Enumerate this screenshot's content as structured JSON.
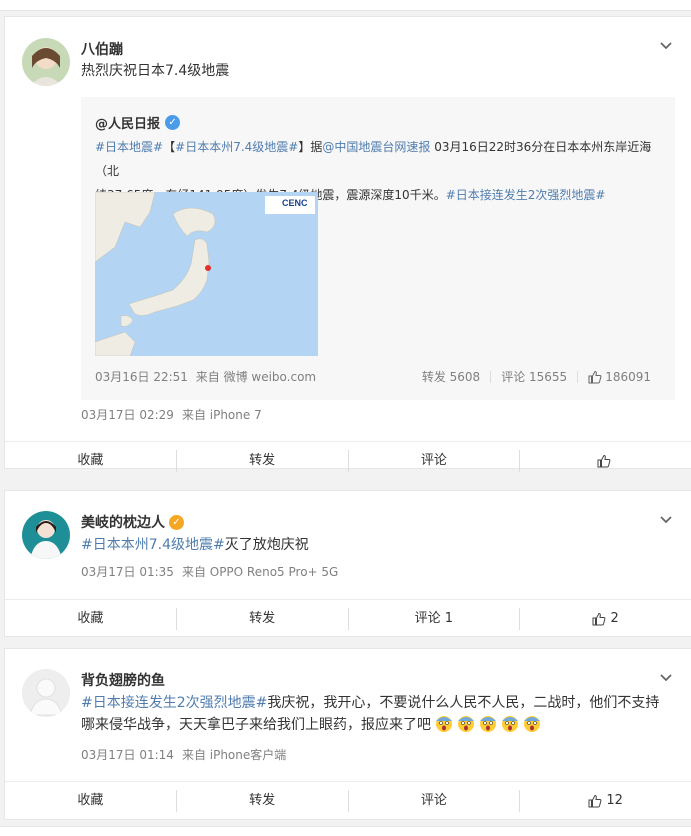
{
  "posts": [
    {
      "username": "八伯蹦",
      "text": "热烈庆祝日本7.4级地震",
      "quote": {
        "author": "@人民日报",
        "topic1": "#日本地震#",
        "bracket_open": "【",
        "topic2": "#日本本州7.4级地震#",
        "bracket_close": "】",
        "ju": "据",
        "mention": "@中国地震台网速报",
        "body_line1_tail": " 03月16日22时36分在日本本州东岸近海（北",
        "body_line2": "纬37.65度，东经141.95度）发生7.4级地震，震源深度10千米。",
        "topic3": "#日本接连发生2次强烈地震#",
        "map_logo": "CENC",
        "time": "03月16日 22:51",
        "source": "来自 微博 weibo.com",
        "repost": "转发 5608",
        "comment": "评论 15655",
        "likes": "186091"
      },
      "time": "03月17日 02:29",
      "source": "来自 iPhone 7",
      "actions": {
        "fav": "收藏",
        "repost": "转发",
        "comment": "评论",
        "like": ""
      }
    },
    {
      "username": "美岐的枕边人",
      "topic": "#日本本州7.4级地震#",
      "text": "灭了放炮庆祝",
      "time": "03月17日 01:35",
      "source": "来自 OPPO Reno5 Pro+ 5G",
      "actions": {
        "fav": "收藏",
        "repost": "转发",
        "comment": "评论 1",
        "like": "2"
      }
    },
    {
      "username": "背负翅膀的鱼",
      "topic": "#日本接连发生2次强烈地震#",
      "text_line1": "我庆祝，我开心，不要说什么人民不人民，二战时，他们不支持",
      "text_line2": "哪来侵华战争，天天拿巴子来给我们上眼药，报应来了吧",
      "time": "03月17日 01:14",
      "source": "来自 iPhone客户端",
      "actions": {
        "fav": "收藏",
        "repost": "转发",
        "comment": "评论",
        "like": "12"
      }
    }
  ],
  "colors": {
    "topic": "#507daf",
    "badge_blue": "#4a9be8",
    "badge_gold": "#f5a623",
    "meta": "#808080"
  }
}
